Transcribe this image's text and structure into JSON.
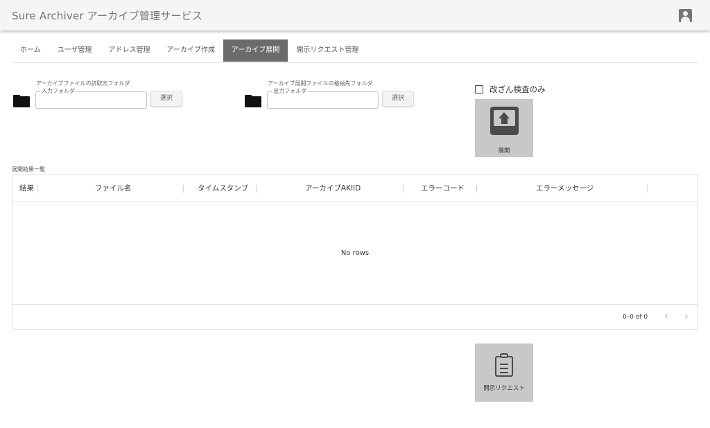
{
  "app": {
    "title": "Sure Archiver アーカイブ管理サービス"
  },
  "header": {
    "account_icon": "account-box-icon"
  },
  "tabs": [
    {
      "label": "ホーム",
      "active": false
    },
    {
      "label": "ユーザ管理",
      "active": false
    },
    {
      "label": "アドレス管理",
      "active": false
    },
    {
      "label": "アーカイブ作成",
      "active": false
    },
    {
      "label": "アーカイブ展開",
      "active": true
    },
    {
      "label": "開示リクエスト管理",
      "active": false
    }
  ],
  "input_folder": {
    "caption": "アーカイブファイルの読取元フォルダ",
    "field_label": "入力フォルダ",
    "value": "",
    "button_label": "選択",
    "icon": "folder-icon"
  },
  "output_folder": {
    "caption": "アーカイブ展開ファイルの格納先フォルダ",
    "field_label": "出力フォルダ",
    "value": "",
    "button_label": "選択",
    "icon": "folder-icon"
  },
  "tamper_check": {
    "label": "改ざん検査のみ",
    "checked": false
  },
  "expand_button": {
    "label": "展開",
    "icon": "unarchive-icon"
  },
  "results": {
    "caption": "展開結果一覧",
    "columns": [
      "結果",
      "ファイル名",
      "タイムスタンプ",
      "アーカイブAKIID",
      "エラーコード",
      "エラーメッセージ"
    ],
    "rows": [],
    "empty_text": "No rows",
    "pagination": "0–0 of 0"
  },
  "disclosure_button": {
    "label": "開示リクエスト",
    "icon": "clipboard-checklist-icon"
  },
  "colors": {
    "active_tab": "#6b6b6b",
    "tile_bg": "#c8c8c8",
    "appbar_bg": "#f5f5f5"
  }
}
